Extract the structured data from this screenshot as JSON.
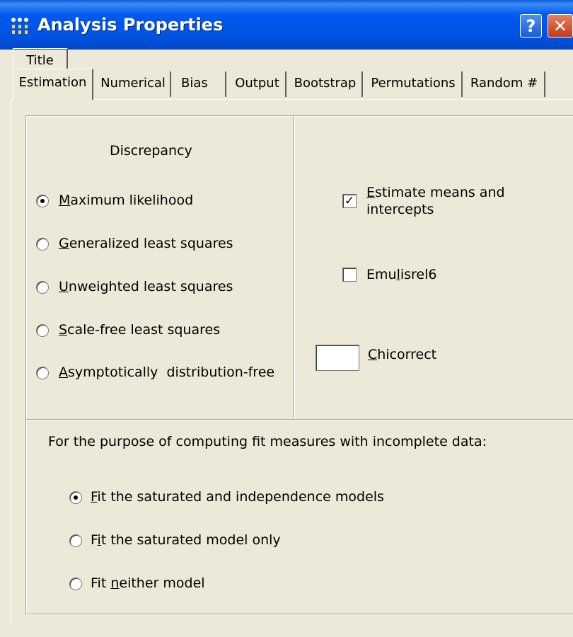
{
  "window": {
    "title": "Analysis Properties",
    "help_label": "?",
    "close_label": "✕"
  },
  "tabs": {
    "row1": [
      {
        "label": "Title"
      }
    ],
    "row2": [
      {
        "label": "Estimation",
        "active": true
      },
      {
        "label": "Numerical"
      },
      {
        "label": "Bias"
      },
      {
        "label": "Output"
      },
      {
        "label": "Bootstrap"
      },
      {
        "label": "Permutations"
      },
      {
        "label": "Random #"
      }
    ]
  },
  "discrepancy": {
    "heading": "Discrepancy",
    "options": [
      {
        "first": "M",
        "rest": "aximum likelihood",
        "selected": true
      },
      {
        "first": "G",
        "rest": "eneralized least squares",
        "selected": false
      },
      {
        "first": "U",
        "rest": "nweighted least squares",
        "selected": false
      },
      {
        "first": "S",
        "rest": "cale-free least squares",
        "selected": false
      },
      {
        "first": "A",
        "rest": "symptotically  distribution-free",
        "selected": false
      }
    ]
  },
  "options": {
    "estimate_means": {
      "line1_first": "E",
      "line1_rest": "stimate means and",
      "line2": "intercepts",
      "checked": true
    },
    "emulisrel": {
      "pre": "Emu",
      "u": "l",
      "post": "isrel6",
      "checked": false
    },
    "chicorrect": {
      "first": "C",
      "rest": "hicorrect",
      "value": ""
    }
  },
  "fit": {
    "heading": "For the purpose of computing fit measures with incomplete data:",
    "options": [
      {
        "pre": "",
        "u": "F",
        "post": "it the saturated and independence models",
        "selected": true
      },
      {
        "pre": "F",
        "u": "i",
        "post": "t the saturated model only",
        "selected": false
      },
      {
        "pre": "Fit ",
        "u": "n",
        "post": "either model",
        "selected": false
      }
    ]
  }
}
